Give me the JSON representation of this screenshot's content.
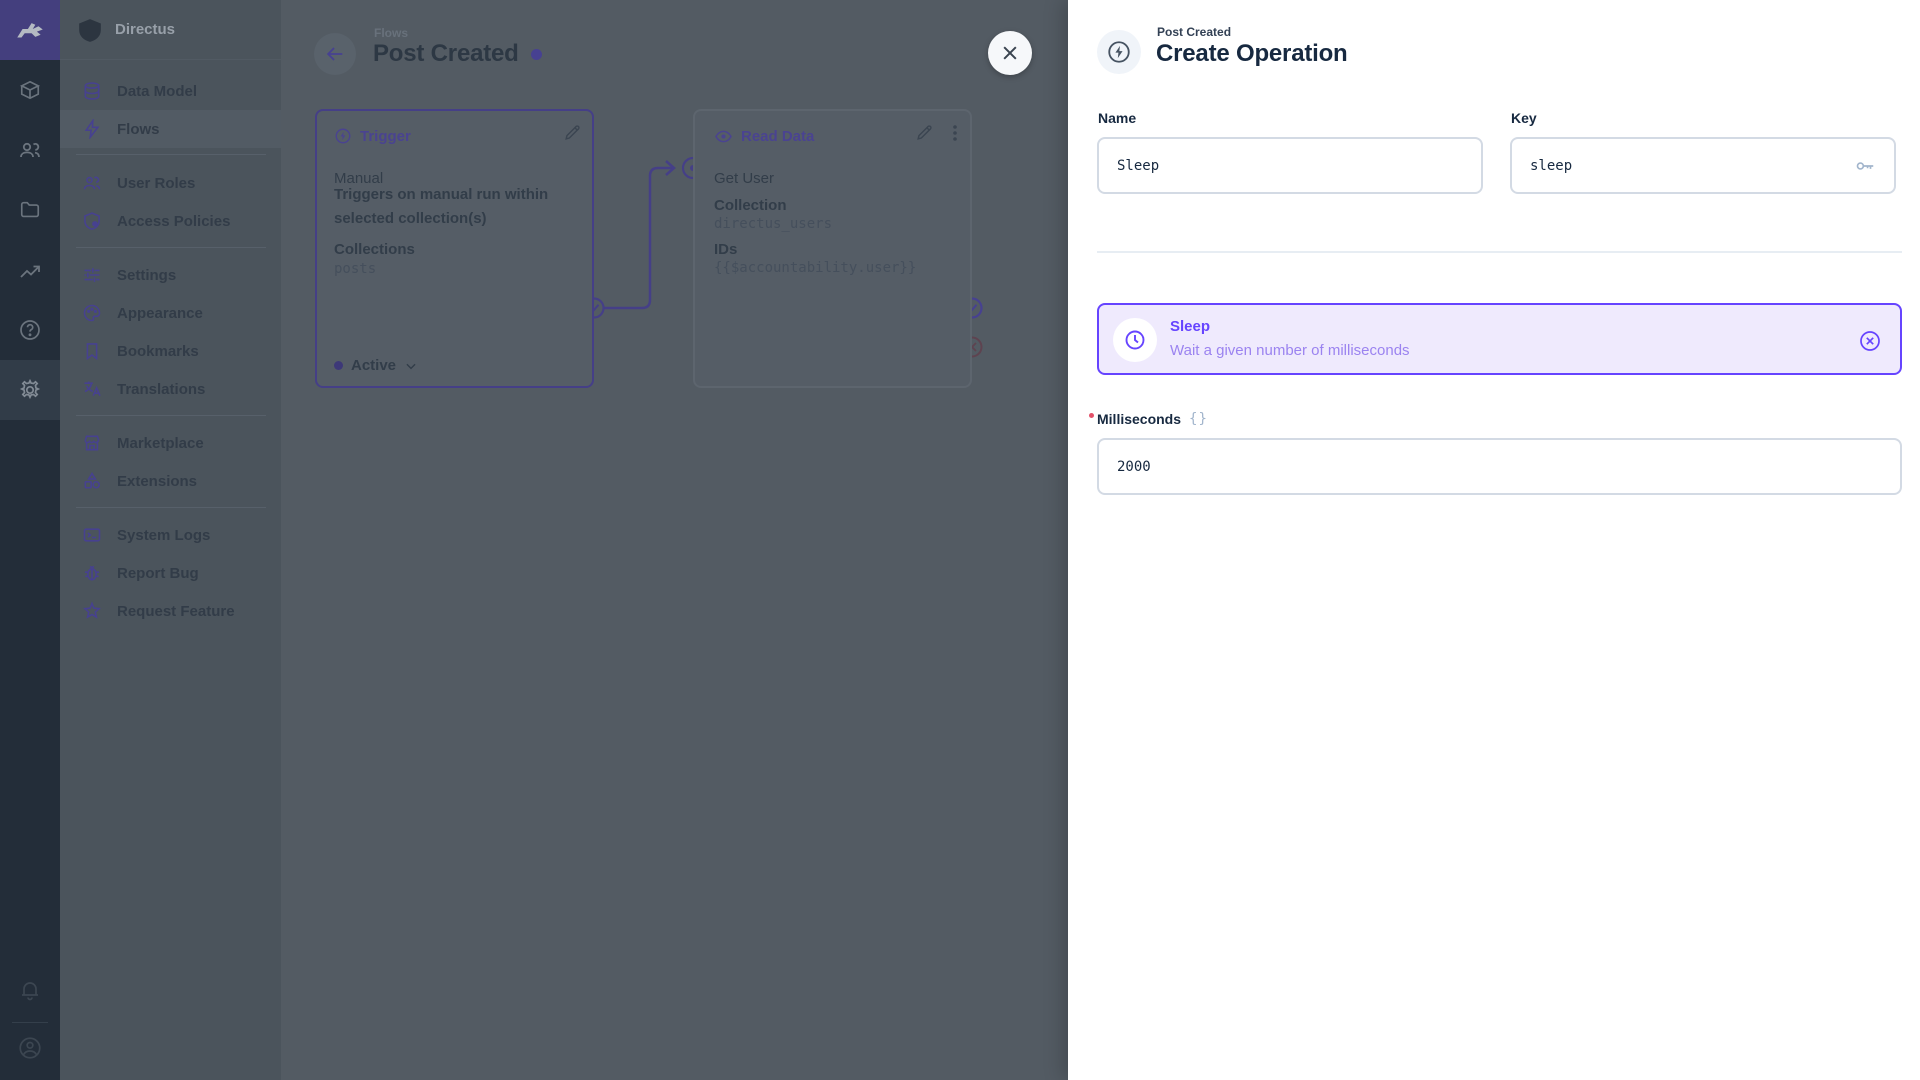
{
  "app": {
    "project_name": "Directus"
  },
  "module_bar": {
    "modules": [
      "content",
      "users",
      "files",
      "insights",
      "docs",
      "settings"
    ],
    "bottom": [
      "notifications",
      "account"
    ]
  },
  "nav": {
    "project": "Directus",
    "items": [
      {
        "label": "Data Model"
      },
      {
        "label": "Flows"
      },
      {
        "label": "User Roles"
      },
      {
        "label": "Access Policies"
      },
      {
        "label": "Settings"
      },
      {
        "label": "Appearance"
      },
      {
        "label": "Bookmarks"
      },
      {
        "label": "Translations"
      },
      {
        "label": "Marketplace"
      },
      {
        "label": "Extensions"
      },
      {
        "label": "System Logs"
      },
      {
        "label": "Report Bug"
      },
      {
        "label": "Request Feature"
      }
    ]
  },
  "flow": {
    "breadcrumb": "Flows",
    "title": "Post Created",
    "trigger_panel": {
      "title": "Trigger",
      "type": "Manual",
      "description": "Triggers on manual run within selected collection(s)",
      "collections_label": "Collections",
      "collections_value": "posts",
      "status": "Active"
    },
    "operation_panel": {
      "title": "Read Data",
      "name": "Get User",
      "collection_label": "Collection",
      "collection_value": "directus_users",
      "ids_label": "IDs",
      "ids_value": "{{$accountability.user}}"
    }
  },
  "drawer": {
    "breadcrumb": "Post Created",
    "title": "Create Operation",
    "name_field": {
      "label": "Name",
      "value": "Sleep"
    },
    "key_field": {
      "label": "Key",
      "value": "sleep"
    },
    "selected_operation": {
      "name": "Sleep",
      "description": "Wait a given number of milliseconds"
    },
    "milliseconds_field": {
      "label": "Milliseconds",
      "value": "2000",
      "braces": "{}"
    }
  },
  "colors": {
    "primary": "#6644ff",
    "banner_bg": "#efeafd",
    "required": "#e35169",
    "module_bar_bg": "#232d39",
    "overlay_canvas": "#535b63"
  }
}
